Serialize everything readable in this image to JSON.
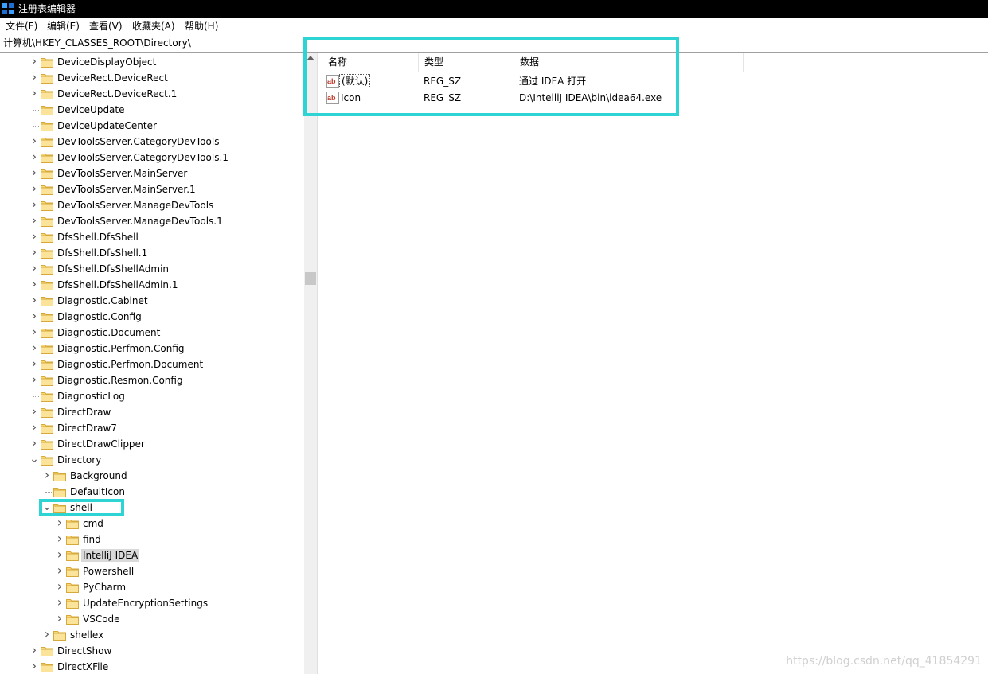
{
  "window": {
    "title": "注册表编辑器",
    "icon": "registry-editor-icon"
  },
  "menu": [
    "文件(F)",
    "编辑(E)",
    "查看(V)",
    "收藏夹(A)",
    "帮助(H)"
  ],
  "address": "计算机\\HKEY_CLASSES_ROOT\\Directory\\",
  "tree": {
    "items": [
      {
        "label": "DeviceDisplayObject",
        "level": 0,
        "expander": "collapsed"
      },
      {
        "label": "DeviceRect.DeviceRect",
        "level": 0,
        "expander": "collapsed"
      },
      {
        "label": "DeviceRect.DeviceRect.1",
        "level": 0,
        "expander": "collapsed"
      },
      {
        "label": "DeviceUpdate",
        "level": 0,
        "expander": "none"
      },
      {
        "label": "DeviceUpdateCenter",
        "level": 0,
        "expander": "none"
      },
      {
        "label": "DevToolsServer.CategoryDevTools",
        "level": 0,
        "expander": "collapsed"
      },
      {
        "label": "DevToolsServer.CategoryDevTools.1",
        "level": 0,
        "expander": "collapsed"
      },
      {
        "label": "DevToolsServer.MainServer",
        "level": 0,
        "expander": "collapsed"
      },
      {
        "label": "DevToolsServer.MainServer.1",
        "level": 0,
        "expander": "collapsed"
      },
      {
        "label": "DevToolsServer.ManageDevTools",
        "level": 0,
        "expander": "collapsed"
      },
      {
        "label": "DevToolsServer.ManageDevTools.1",
        "level": 0,
        "expander": "collapsed"
      },
      {
        "label": "DfsShell.DfsShell",
        "level": 0,
        "expander": "collapsed"
      },
      {
        "label": "DfsShell.DfsShell.1",
        "level": 0,
        "expander": "collapsed"
      },
      {
        "label": "DfsShell.DfsShellAdmin",
        "level": 0,
        "expander": "collapsed"
      },
      {
        "label": "DfsShell.DfsShellAdmin.1",
        "level": 0,
        "expander": "collapsed"
      },
      {
        "label": "Diagnostic.Cabinet",
        "level": 0,
        "expander": "collapsed"
      },
      {
        "label": "Diagnostic.Config",
        "level": 0,
        "expander": "collapsed"
      },
      {
        "label": "Diagnostic.Document",
        "level": 0,
        "expander": "collapsed"
      },
      {
        "label": "Diagnostic.Perfmon.Config",
        "level": 0,
        "expander": "collapsed"
      },
      {
        "label": "Diagnostic.Perfmon.Document",
        "level": 0,
        "expander": "collapsed"
      },
      {
        "label": "Diagnostic.Resmon.Config",
        "level": 0,
        "expander": "collapsed"
      },
      {
        "label": "DiagnosticLog",
        "level": 0,
        "expander": "none"
      },
      {
        "label": "DirectDraw",
        "level": 0,
        "expander": "collapsed"
      },
      {
        "label": "DirectDraw7",
        "level": 0,
        "expander": "collapsed"
      },
      {
        "label": "DirectDrawClipper",
        "level": 0,
        "expander": "collapsed"
      },
      {
        "label": "Directory",
        "level": 0,
        "expander": "expanded"
      },
      {
        "label": "Background",
        "level": 1,
        "expander": "collapsed"
      },
      {
        "label": "DefaultIcon",
        "level": 1,
        "expander": "none"
      },
      {
        "label": "shell",
        "level": 1,
        "expander": "expanded"
      },
      {
        "label": "cmd",
        "level": 2,
        "expander": "collapsed"
      },
      {
        "label": "find",
        "level": 2,
        "expander": "collapsed"
      },
      {
        "label": "IntelliJ IDEA",
        "level": 2,
        "expander": "collapsed",
        "selected": true
      },
      {
        "label": "Powershell",
        "level": 2,
        "expander": "collapsed"
      },
      {
        "label": "PyCharm",
        "level": 2,
        "expander": "collapsed"
      },
      {
        "label": "UpdateEncryptionSettings",
        "level": 2,
        "expander": "collapsed"
      },
      {
        "label": "VSCode",
        "level": 2,
        "expander": "collapsed"
      },
      {
        "label": "shellex",
        "level": 1,
        "expander": "collapsed"
      },
      {
        "label": "DirectShow",
        "level": 0,
        "expander": "collapsed"
      },
      {
        "label": "DirectXFile",
        "level": 0,
        "expander": "collapsed"
      }
    ]
  },
  "values_list": {
    "columns": [
      "名称",
      "类型",
      "数据"
    ],
    "rows": [
      {
        "name": "(默认)",
        "type": "REG_SZ",
        "data": "通过 IDEA 打开"
      },
      {
        "name": "Icon",
        "type": "REG_SZ",
        "data": "D:\\IntelliJ IDEA\\bin\\idea64.exe"
      }
    ]
  },
  "colors": {
    "highlight": "#2ed3d3",
    "folder": "#f8d775",
    "titlebar": "#000000"
  },
  "watermark": "https://blog.csdn.net/qq_41854291"
}
